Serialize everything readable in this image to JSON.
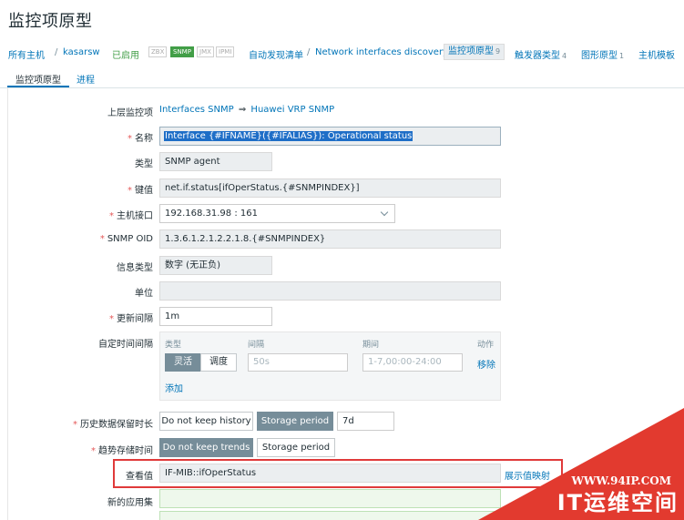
{
  "page": {
    "title": "监控项原型"
  },
  "nav": {
    "all_hosts": "所有主机",
    "separator": "/",
    "host": "kasarsw",
    "enabled": "已启用",
    "badges": [
      "ZBX",
      "SNMP",
      "JMX",
      "IPMI"
    ],
    "active_badge": "SNMP",
    "discovery_list": "自动发现清单",
    "discovery_rule": "Network interfaces discovery",
    "item_prototypes": "监控项原型",
    "item_prototypes_count": "9",
    "trigger_prototypes": "触发器类型",
    "trigger_prototypes_count": "4",
    "graph_prototypes": "图形原型",
    "graph_prototypes_count": "1",
    "host_templates": "主机模板"
  },
  "tabs": [
    {
      "label": "监控项原型",
      "active": true
    },
    {
      "label": "进程",
      "active": false
    }
  ],
  "form": {
    "parent_items": {
      "label": "上层监控项",
      "value_a": "Interfaces SNMP",
      "eq": "⇒",
      "value_b": "Huawei VRP SNMP"
    },
    "name": {
      "label": "名称",
      "value": "Interface {#IFNAME}({#IFALIAS}): Operational status"
    },
    "type": {
      "label": "类型",
      "value": "SNMP agent"
    },
    "key": {
      "label": "键值",
      "value": "net.if.status[ifOperStatus.{#SNMPINDEX}]"
    },
    "host_interface": {
      "label": "主机接口",
      "value": "192.168.31.98 : 161"
    },
    "snmp_oid": {
      "label": "SNMP OID",
      "value": "1.3.6.1.2.1.2.2.1.8.{#SNMPINDEX}"
    },
    "info_type": {
      "label": "信息类型",
      "value": "数字 (无正负)"
    },
    "units": {
      "label": "单位",
      "value": ""
    },
    "update_interval": {
      "label": "更新间隔",
      "value": "1m"
    },
    "custom_intervals": {
      "label": "自定时间间隔",
      "col_type": "类型",
      "col_interval": "间隔",
      "col_period": "期间",
      "col_action": "动作",
      "flexible": "灵活",
      "scheduling": "调度",
      "interval_placeholder": "50s",
      "period_placeholder": "1-7,00:00-24:00",
      "remove": "移除",
      "add": "添加"
    },
    "history": {
      "label": "历史数据保留时长",
      "opt_no": "Do not keep history",
      "opt_storage": "Storage period",
      "value": "7d"
    },
    "trends": {
      "label": "趋势存储时间",
      "opt_no": "Do not keep trends",
      "opt_storage": "Storage period"
    },
    "show_value": {
      "label": "查看值",
      "value": "IF-MIB::ifOperStatus",
      "mapping_link": "展示值映射"
    },
    "new_app": {
      "label": "新的应用集"
    }
  },
  "watermark": {
    "url": "WWW.94IP.COM",
    "brand": "IT运维空间"
  },
  "colors": {
    "link": "#0275b8",
    "enabled": "#429e47",
    "highlight": "#e03a3a",
    "watermark": "#e23a2f"
  }
}
